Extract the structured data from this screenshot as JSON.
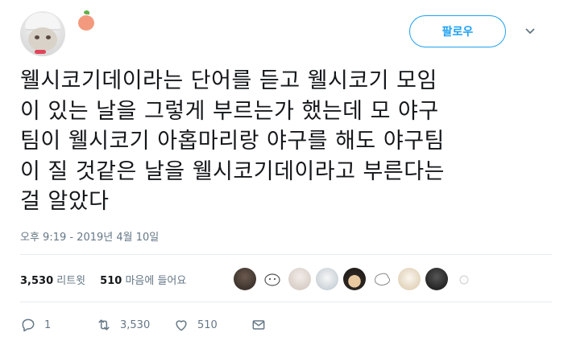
{
  "header": {
    "follow_label": "팔로우"
  },
  "tweet": {
    "lines": [
      "웰시코기데이라는 단어를 듣고 웰시코기 모임",
      "이 있는 날을 그렇게 부르는가 했는데 모 야구",
      "팀이 웰시코기 아홉마리랑 야구를 해도 야구팀",
      "이 질 것같은 날을 웰시코기데이라고 부른다는",
      "걸 알았다"
    ],
    "timestamp": "오후 9:19 - 2019년 4월 10일"
  },
  "stats": {
    "retweets_count": "3,530",
    "retweets_label": "리트윗",
    "likes_count": "510",
    "likes_label": "마음에 들어요"
  },
  "actions": {
    "reply_count": "1",
    "retweet_count": "3,530",
    "like_count": "510"
  },
  "colors": {
    "accent": "#1da1f2",
    "text": "#14171a",
    "muted": "#657786"
  },
  "icons": [
    "chevron-down-icon",
    "reply-icon",
    "retweet-icon",
    "heart-icon",
    "message-icon"
  ]
}
